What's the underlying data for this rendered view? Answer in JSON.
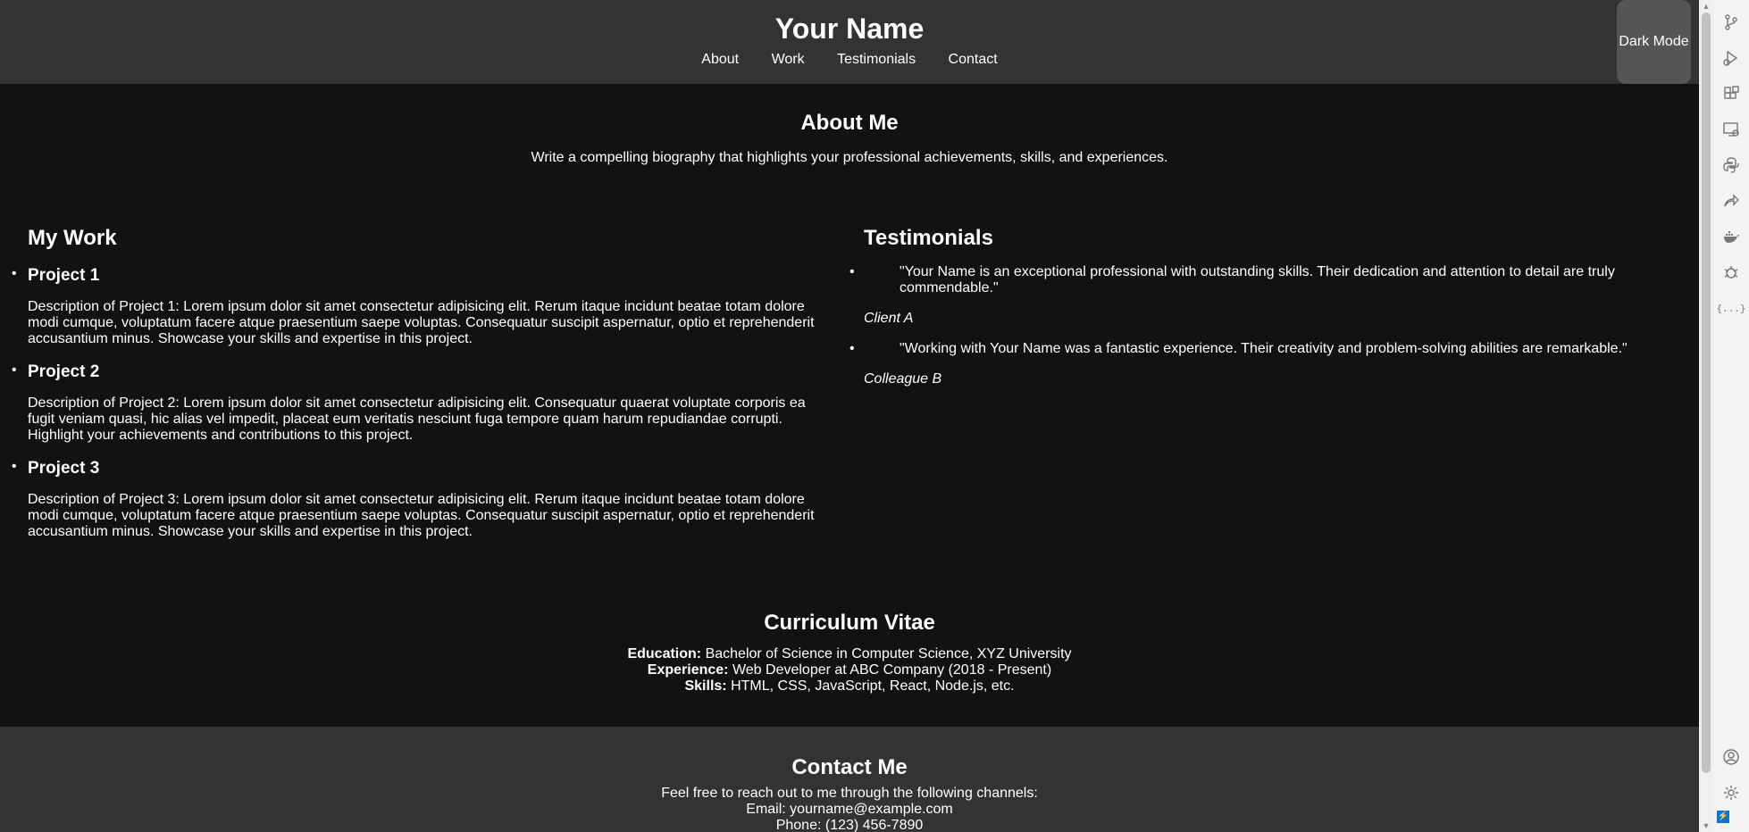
{
  "header": {
    "title": "Your Name",
    "nav": [
      "About",
      "Work",
      "Testimonials",
      "Contact"
    ],
    "dark_mode_label": "Dark Mode"
  },
  "about": {
    "heading": "About Me",
    "text": "Write a compelling biography that highlights your professional achievements, skills, and experiences."
  },
  "work": {
    "heading": "My Work",
    "projects": [
      {
        "title": "Project 1",
        "lines": [
          "Description of Project 1: Lorem ipsum dolor sit amet consectetur adipisicing elit. Rerum itaque incidunt beatae totam dolore",
          "modi cumque, voluptatum facere atque praesentium saepe voluptas. Consequatur suscipit aspernatur, optio et reprehenderit",
          "accusantium minus. Showcase your skills and expertise in this project."
        ]
      },
      {
        "title": "Project 2",
        "lines": [
          "Description of Project 2: Lorem ipsum dolor sit amet consectetur adipisicing elit. Consequatur quaerat voluptate corporis ea",
          "fugit veniam quasi, hic alias vel impedit, placeat eum veritatis nesciunt fuga tempore quam harum repudiandae corrupti.",
          "Highlight your achievements and contributions to this project."
        ]
      },
      {
        "title": "Project 3",
        "lines": [
          "Description of Project 3: Lorem ipsum dolor sit amet consectetur adipisicing elit. Rerum itaque incidunt beatae totam dolore",
          "modi cumque, voluptatum facere atque praesentium saepe voluptas. Consequatur suscipit aspernatur, optio et reprehenderit",
          "accusantium minus. Showcase your skills and expertise in this project."
        ]
      }
    ]
  },
  "testimonials": {
    "heading": "Testimonials",
    "items": [
      {
        "lines": [
          "\"Your Name is an exceptional professional with outstanding skills. Their dedication and attention to detail are truly",
          "commendable.\""
        ],
        "author": "Client A"
      },
      {
        "lines": [
          "\"Working with Your Name was a fantastic experience. Their creativity and problem-solving abilities are remarkable.\""
        ],
        "author": "Colleague B"
      }
    ]
  },
  "cv": {
    "heading": "Curriculum Vitae",
    "rows": [
      {
        "label": "Education:",
        "value": "Bachelor of Science in Computer Science, XYZ University"
      },
      {
        "label": "Experience:",
        "value": "Web Developer at ABC Company (2018 - Present)"
      },
      {
        "label": "Skills:",
        "value": "HTML, CSS, JavaScript, React, Node.js, etc."
      }
    ]
  },
  "contact": {
    "heading": "Contact Me",
    "intro": "Feel free to reach out to me through the following channels:",
    "email": "Email: yourname@example.com",
    "phone": "Phone: (123) 456-7890"
  },
  "activity_bar": {
    "icons": [
      "source-control-icon",
      "run-debug-icon",
      "extensions-icon",
      "remote-explorer-icon",
      "python-icon",
      "live-share-icon",
      "docker-icon",
      "testing-icon",
      "json-icon",
      "account-icon",
      "settings-icon"
    ],
    "json_glyph": "{...}",
    "status_glyph": "⚡"
  }
}
